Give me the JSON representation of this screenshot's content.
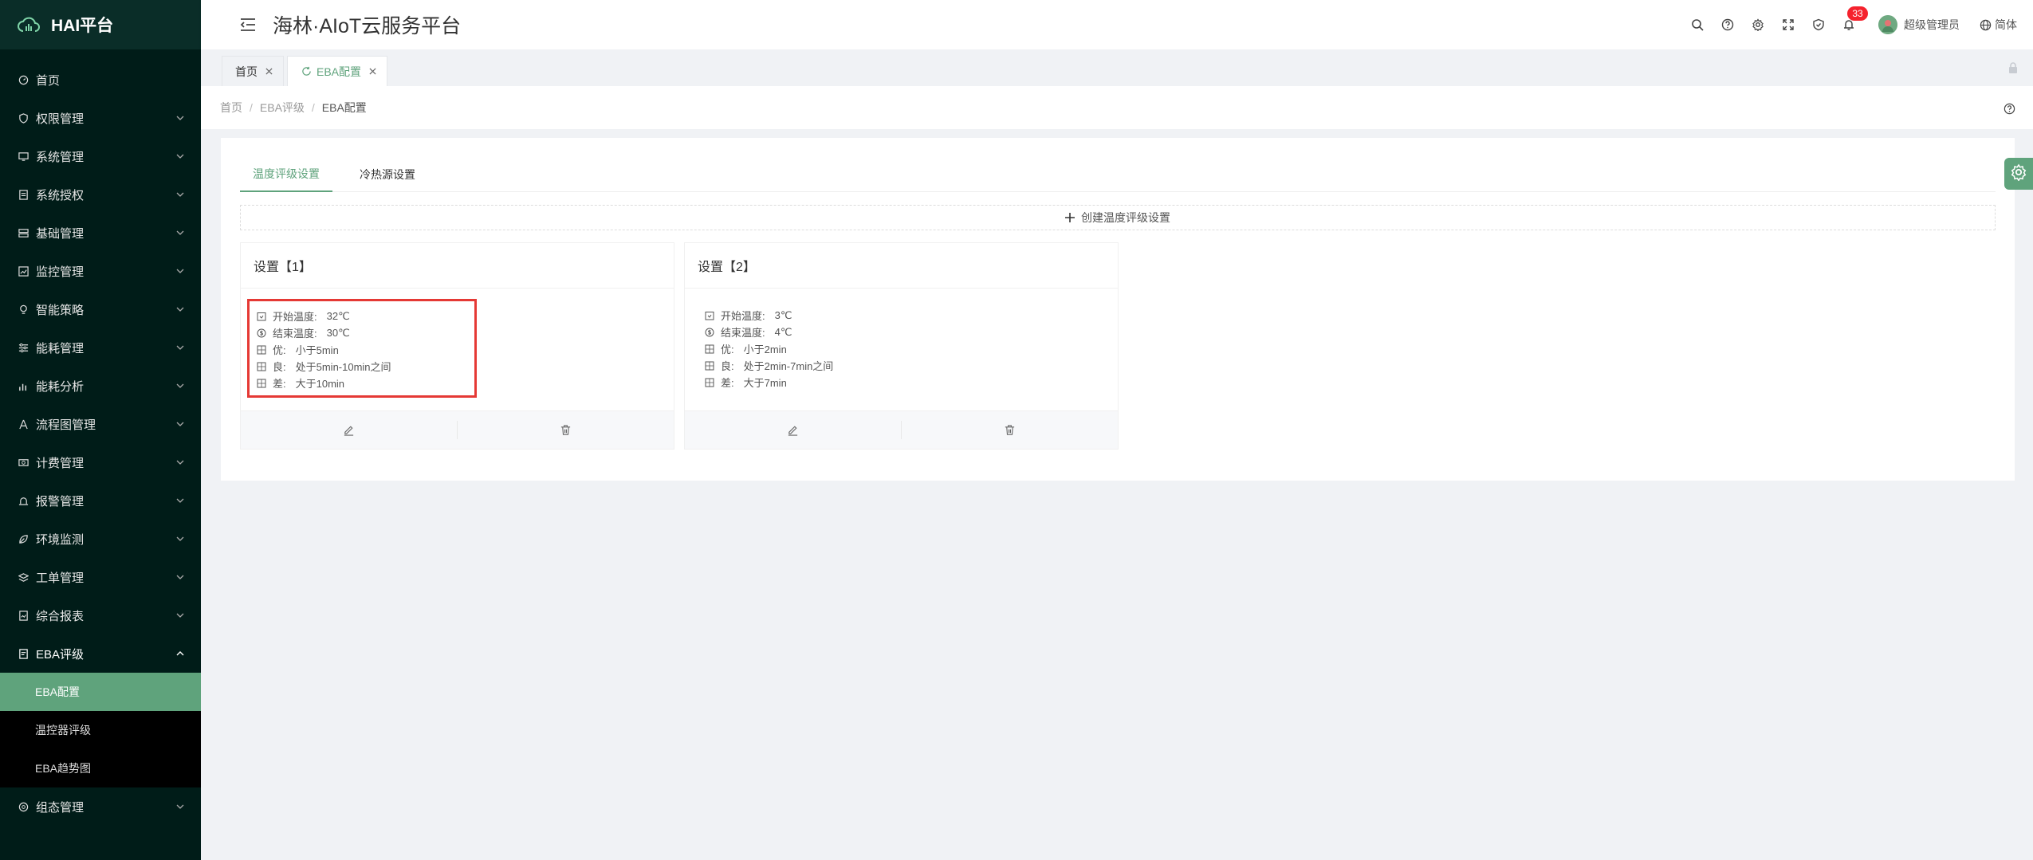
{
  "brand": {
    "name": "HAI平台"
  },
  "header": {
    "title": "海林·AIoT云服务平台",
    "notification_count": "33",
    "username": "超级管理员",
    "language": "简体"
  },
  "sidebar": {
    "items": [
      {
        "label": "首页",
        "icon": "dashboard-icon"
      },
      {
        "label": "权限管理",
        "icon": "shield-icon"
      },
      {
        "label": "系统管理",
        "icon": "monitor-icon"
      },
      {
        "label": "系统授权",
        "icon": "document-icon"
      },
      {
        "label": "基础管理",
        "icon": "server-icon"
      },
      {
        "label": "监控管理",
        "icon": "chart-icon"
      },
      {
        "label": "智能策略",
        "icon": "bulb-icon"
      },
      {
        "label": "能耗管理",
        "icon": "sliders-icon"
      },
      {
        "label": "能耗分析",
        "icon": "bar-chart-icon"
      },
      {
        "label": "流程图管理",
        "icon": "flow-icon"
      },
      {
        "label": "计费管理",
        "icon": "money-icon"
      },
      {
        "label": "报警管理",
        "icon": "alarm-icon"
      },
      {
        "label": "环境监测",
        "icon": "leaf-icon"
      },
      {
        "label": "工单管理",
        "icon": "layers-icon"
      },
      {
        "label": "综合报表",
        "icon": "report-icon"
      },
      {
        "label": "EBA评级",
        "icon": "rating-icon"
      },
      {
        "label": "组态管理",
        "icon": "config-icon"
      }
    ],
    "eba_sub": [
      {
        "label": "EBA配置"
      },
      {
        "label": "温控器评级"
      },
      {
        "label": "EBA趋势图"
      }
    ]
  },
  "tabs": [
    {
      "label": "首页"
    },
    {
      "label": "EBA配置"
    }
  ],
  "breadcrumb": [
    "首页",
    "EBA评级",
    "EBA配置"
  ],
  "page_tabs": [
    "温度评级设置",
    "冷热源设置"
  ],
  "create_label": "创建温度评级设置",
  "cards": [
    {
      "title": "设置【1】",
      "rows": [
        {
          "label": "开始温度:",
          "value": "32℃"
        },
        {
          "label": "结束温度:",
          "value": "30℃"
        },
        {
          "label": "优:",
          "value": "小于5min"
        },
        {
          "label": "良:",
          "value": "处于5min-10min之间"
        },
        {
          "label": "差:",
          "value": "大于10min"
        }
      ]
    },
    {
      "title": "设置【2】",
      "rows": [
        {
          "label": "开始温度:",
          "value": "3℃"
        },
        {
          "label": "结束温度:",
          "value": "4℃"
        },
        {
          "label": "优:",
          "value": "小于2min"
        },
        {
          "label": "良:",
          "value": "处于2min-7min之间"
        },
        {
          "label": "差:",
          "value": "大于7min"
        }
      ]
    }
  ],
  "colors": {
    "accent": "#5fa37c",
    "sidebar_bg": "#001c18",
    "highlight": "#e53935",
    "badge": "#f5222d"
  }
}
